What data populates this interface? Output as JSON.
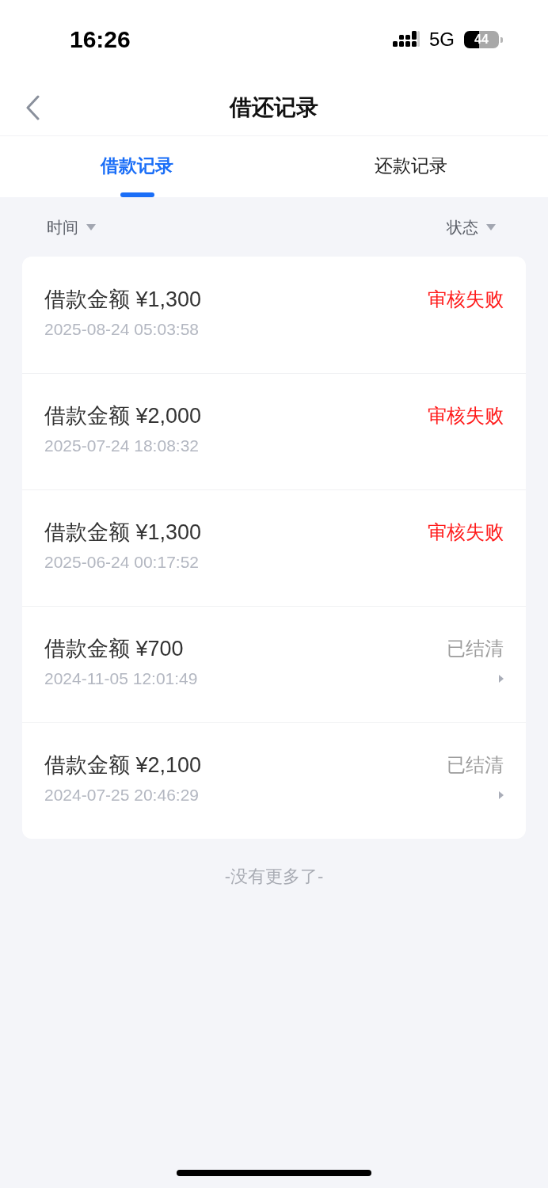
{
  "status_bar": {
    "time": "16:26",
    "network": "5G",
    "battery": "44"
  },
  "nav": {
    "title": "借还记录"
  },
  "tabs": [
    {
      "label": "借款记录",
      "selected": true
    },
    {
      "label": "还款记录",
      "selected": false
    }
  ],
  "filters": [
    {
      "label": "时间"
    },
    {
      "label": "状态"
    }
  ],
  "records": [
    {
      "amount": "借款金额 ¥1,300",
      "time": "2025-08-24 05:03:58",
      "status": "审核失败",
      "kind": "failed"
    },
    {
      "amount": "借款金额 ¥2,000",
      "time": "2025-07-24 18:08:32",
      "status": "审核失败",
      "kind": "failed"
    },
    {
      "amount": "借款金额 ¥1,300",
      "time": "2025-06-24 00:17:52",
      "status": "审核失败",
      "kind": "failed"
    },
    {
      "amount": "借款金额 ¥700",
      "time": "2024-11-05 12:01:49",
      "status": "已结清",
      "kind": "settled"
    },
    {
      "amount": "借款金额 ¥2,100",
      "time": "2024-07-25 20:46:29",
      "status": "已结清",
      "kind": "settled"
    }
  ],
  "footer": "-没有更多了-"
}
